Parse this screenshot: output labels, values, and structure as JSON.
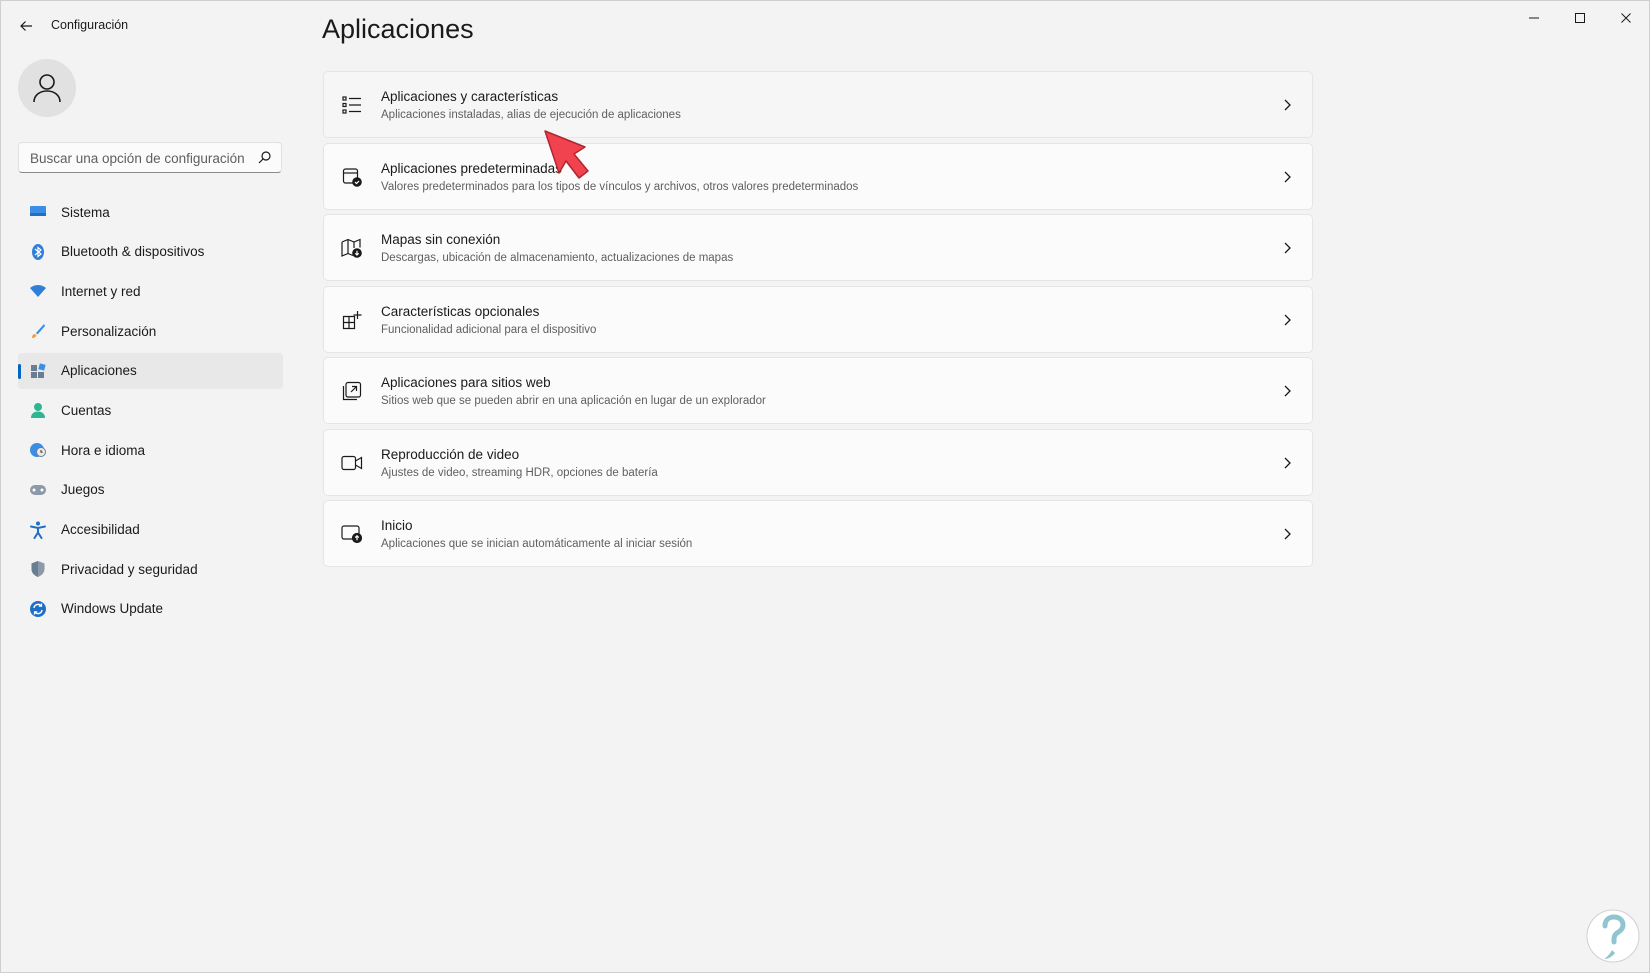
{
  "window": {
    "title": "Configuración",
    "controls": [
      "minimize",
      "maximize",
      "close"
    ]
  },
  "sidebar": {
    "search_placeholder": "Buscar una opción de configuración",
    "items": [
      {
        "label": "Sistema",
        "icon": "monitor-icon"
      },
      {
        "label": "Bluetooth & dispositivos",
        "icon": "bluetooth-icon"
      },
      {
        "label": "Internet y red",
        "icon": "wifi-icon"
      },
      {
        "label": "Personalización",
        "icon": "brush-icon"
      },
      {
        "label": "Aplicaciones",
        "icon": "apps-icon",
        "selected": true
      },
      {
        "label": "Cuentas",
        "icon": "person-icon"
      },
      {
        "label": "Hora e idioma",
        "icon": "globe-clock-icon"
      },
      {
        "label": "Juegos",
        "icon": "gamepad-icon"
      },
      {
        "label": "Accesibilidad",
        "icon": "accessibility-icon"
      },
      {
        "label": "Privacidad y seguridad",
        "icon": "shield-icon"
      },
      {
        "label": "Windows Update",
        "icon": "update-icon"
      }
    ]
  },
  "main": {
    "title": "Aplicaciones",
    "cards": [
      {
        "title": "Aplicaciones y características",
        "desc": "Aplicaciones instaladas, alias de ejecución de aplicaciones",
        "icon": "list-icon"
      },
      {
        "title": "Aplicaciones predeterminadas",
        "desc": "Valores predeterminados para los tipos de vínculos y archivos, otros valores predeterminados",
        "icon": "default-apps-icon"
      },
      {
        "title": "Mapas sin conexión",
        "desc": "Descargas, ubicación de almacenamiento, actualizaciones de mapas",
        "icon": "map-download-icon"
      },
      {
        "title": "Características opcionales",
        "desc": "Funcionalidad adicional para el dispositivo",
        "icon": "optional-features-icon"
      },
      {
        "title": "Aplicaciones para sitios web",
        "desc": "Sitios web que se pueden abrir en una aplicación en lugar de un explorador",
        "icon": "open-in-app-icon"
      },
      {
        "title": "Reproducción de video",
        "desc": "Ajustes de video, streaming HDR, opciones de batería",
        "icon": "video-icon"
      },
      {
        "title": "Inicio",
        "desc": "Aplicaciones que se inician automáticamente al iniciar sesión",
        "icon": "startup-icon"
      }
    ]
  },
  "colors": {
    "accent": "#0067c0",
    "background": "#f3f3f3",
    "card": "#fbfbfb",
    "annotation_arrow": "#f0424f"
  }
}
